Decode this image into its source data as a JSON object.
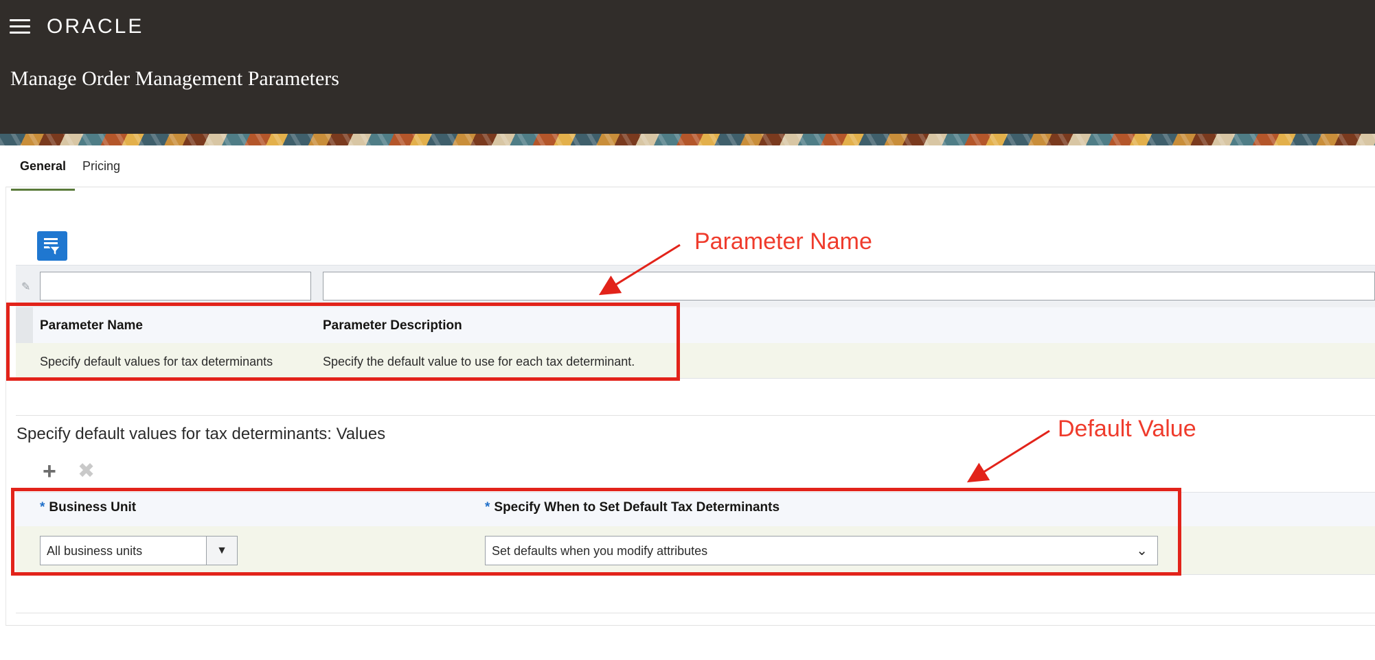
{
  "header": {
    "logo_text": "ORACLE",
    "page_title": "Manage Order Management Parameters"
  },
  "tabs": [
    {
      "label": "General",
      "active": true
    },
    {
      "label": "Pricing",
      "active": false
    }
  ],
  "parameters_table": {
    "filter_values": [
      "",
      ""
    ],
    "columns": [
      "Parameter Name",
      "Parameter Description"
    ],
    "rows": [
      [
        "Specify default values for tax determinants",
        "Specify the default value to use for each tax determinant."
      ]
    ]
  },
  "values_section": {
    "title": "Specify default values for tax determinants: Values",
    "toolbar": {
      "add_icon": "plus-icon",
      "delete_icon": "close-icon"
    },
    "columns": [
      {
        "required_mark": "*",
        "label": "Business Unit"
      },
      {
        "required_mark": "*",
        "label": "Specify When to Set Default Tax Determinants"
      }
    ],
    "rows": [
      {
        "business_unit": "All business units",
        "when_to_set": "Set defaults when you modify attributes"
      }
    ]
  },
  "annotations": {
    "parameter_name": "Parameter Name",
    "default_value": "Default Value"
  },
  "colors": {
    "header_bg": "#312d2a",
    "accent_blue": "#1f77d0",
    "annotation_red": "#e2231a",
    "active_tab_underline": "#5a7a3a"
  }
}
